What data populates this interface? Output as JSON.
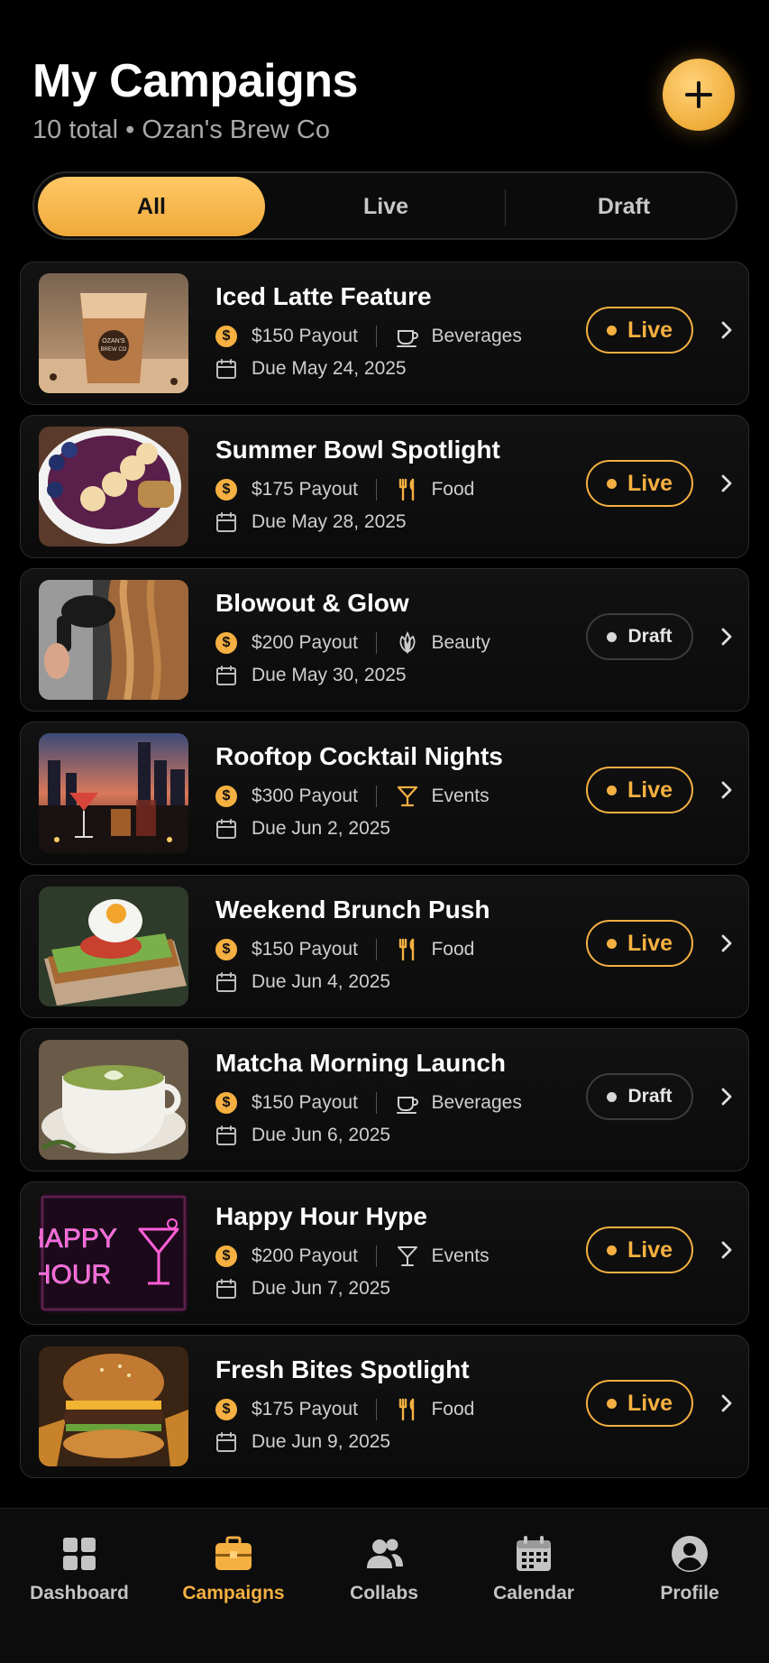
{
  "header": {
    "title": "My Campaigns",
    "subtitle": "10 total • Ozan's Brew Co"
  },
  "tabs": [
    {
      "label": "All",
      "active": true
    },
    {
      "label": "Live",
      "active": false
    },
    {
      "label": "Draft",
      "active": false
    }
  ],
  "campaigns": [
    {
      "title": "Iced Latte Feature",
      "payout": "$150 Payout",
      "category": "Beverages",
      "category_icon": "coffee-cup-icon",
      "due": "Due May 24, 2025",
      "status": "Live",
      "thumb_label": "OZAN'S BREW CO"
    },
    {
      "title": "Summer Bowl Spotlight",
      "payout": "$175 Payout",
      "category": "Food",
      "category_icon": "fork-knife-icon",
      "due": "Due May 28, 2025",
      "status": "Live"
    },
    {
      "title": "Blowout & Glow",
      "payout": "$200 Payout",
      "category": "Beauty",
      "category_icon": "leaf-icon",
      "due": "Due May 30, 2025",
      "status": "Draft"
    },
    {
      "title": "Rooftop Cocktail Nights",
      "payout": "$300 Payout",
      "category": "Events",
      "category_icon": "cocktail-glass-icon",
      "due": "Due Jun 2, 2025",
      "status": "Live"
    },
    {
      "title": "Weekend Brunch Push",
      "payout": "$150 Payout",
      "category": "Food",
      "category_icon": "fork-knife-icon",
      "due": "Due Jun 4, 2025",
      "status": "Live"
    },
    {
      "title": "Matcha Morning Launch",
      "payout": "$150 Payout",
      "category": "Beverages",
      "category_icon": "coffee-cup-icon",
      "due": "Due Jun 6, 2025",
      "status": "Draft"
    },
    {
      "title": "Happy Hour Hype",
      "payout": "$200 Payout",
      "category": "Events",
      "category_icon": "cocktail-glass-icon",
      "due": "Due Jun 7, 2025",
      "status": "Live",
      "thumb_label_1": "HAPPY",
      "thumb_label_2": "HOUR"
    },
    {
      "title": "Fresh Bites Spotlight",
      "payout": "$175 Payout",
      "category": "Food",
      "category_icon": "fork-knife-icon",
      "due": "Due Jun 9, 2025",
      "status": "Live"
    }
  ],
  "nav": [
    {
      "label": "Dashboard",
      "icon": "grid-icon",
      "active": false
    },
    {
      "label": "Campaigns",
      "icon": "briefcase-icon",
      "active": true
    },
    {
      "label": "Collabs",
      "icon": "people-icon",
      "active": false
    },
    {
      "label": "Calendar",
      "icon": "calendar-icon",
      "active": false
    },
    {
      "label": "Profile",
      "icon": "user-circle-icon",
      "active": false
    }
  ],
  "colors": {
    "accent": "#f5b041",
    "background": "#000000",
    "card": "#121212"
  }
}
